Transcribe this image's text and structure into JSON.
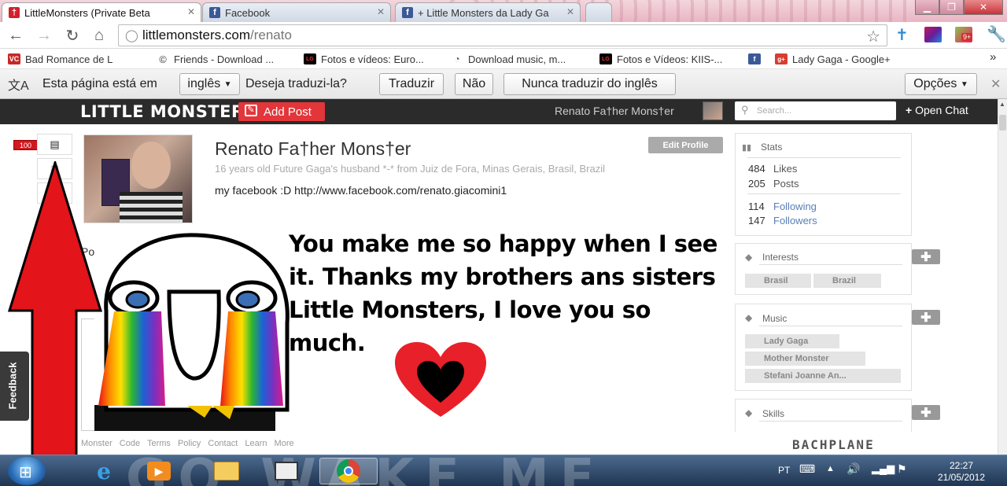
{
  "browser": {
    "tabs": [
      {
        "title": "LittleMonsters (Private Beta",
        "icon": "littlemonsters-icon",
        "active": true
      },
      {
        "title": "Facebook",
        "icon": "facebook-icon",
        "active": false
      },
      {
        "title": "+ Little Monsters da Lady Ga",
        "icon": "facebook-icon",
        "active": false
      }
    ],
    "address": {
      "host": "littlemonsters.com",
      "path": "/renato"
    },
    "bookmarks": [
      {
        "label": "Bad Romance de L",
        "icon": "vc-icon"
      },
      {
        "label": "Friends - Download ...",
        "icon": "c-icon"
      },
      {
        "label": "Fotos e vídeos: Euro...",
        "icon": "lg-icon"
      },
      {
        "label": "Download music, m...",
        "icon": "music-icon"
      },
      {
        "label": "Fotos e Vídeos: KIIS-...",
        "icon": "lg-icon"
      },
      {
        "label": "",
        "icon": "facebook-icon"
      },
      {
        "label": "Lady Gaga - Google+",
        "icon": "google-plus-icon"
      }
    ],
    "notification_badge": "9+"
  },
  "translate_bar": {
    "prefix": "Esta página está em",
    "language": "inglês",
    "question": "Deseja traduzi-la?",
    "translate_button": "Traduzir",
    "no_button": "Não",
    "never_button": "Nunca traduzir do inglês",
    "options_button": "Opções"
  },
  "site": {
    "logo": "LITTLE MONSTERS",
    "add_post": "Add Post",
    "user_name": "Renato Fa†her Mons†er",
    "search_placeholder": "Search...",
    "open_chat": "Open Chat",
    "notifications_count": "100"
  },
  "profile": {
    "name": "Renato Fa†her Mons†er",
    "subtitle": "16 years old Future Gaga's husband *-* from Juiz de Fora, Minas Gerais, Brasil, Brazil",
    "bio": "my facebook :D http://www.facebook.com/renato.giacomini1",
    "edit_button": "Edit Profile",
    "tab_partial": "Po"
  },
  "stats": {
    "title": "Stats",
    "likes": {
      "value": "484",
      "label": "Likes"
    },
    "posts": {
      "value": "205",
      "label": "Posts"
    },
    "following": {
      "value": "114",
      "label": "Following"
    },
    "followers": {
      "value": "147",
      "label": "Followers"
    }
  },
  "interests": {
    "title": "Interests",
    "tags": [
      "Brasil",
      "Brazil"
    ]
  },
  "music": {
    "title": "Music",
    "tags": [
      "Lady Gaga",
      "Mother Monster",
      "Stefani Joanne An..."
    ]
  },
  "skills": {
    "title": "Skills"
  },
  "footer": {
    "links": [
      "Monster Code",
      "Terms",
      "Policy",
      "Contact",
      "Learn More"
    ],
    "brand": "BACHPLANE"
  },
  "feedback": "Feedback",
  "meme": {
    "text": "You make me so happy when I see it. Thanks my brothers ans sisters Little Monsters, I love you so much."
  },
  "taskbar": {
    "lang": "PT",
    "time": "22:27",
    "date": "21/05/2012",
    "watermark": "GO WAKE ME"
  },
  "colors": {
    "accent_red": "#e2363a",
    "header_dark": "#2b2b2b",
    "link_blue": "#5a7eb8",
    "heart_red": "#e8202a"
  }
}
